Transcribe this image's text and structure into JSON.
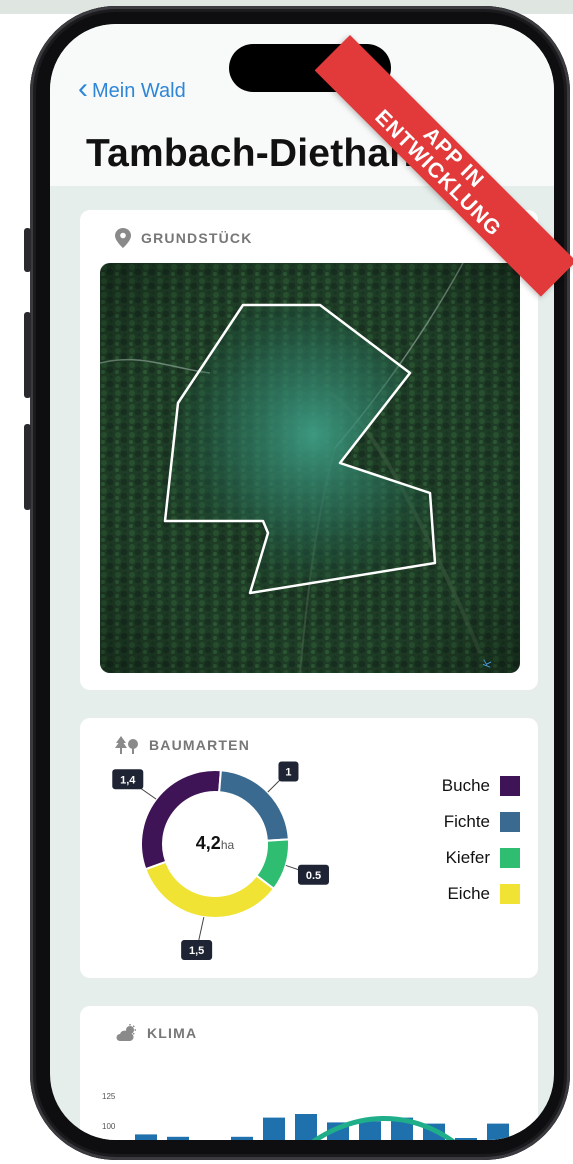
{
  "nav": {
    "back_label": "Mein Wald"
  },
  "header": {
    "title": "Tambach-Dietharz"
  },
  "banner": {
    "line1": "APP IN",
    "line2": "ENTWICKLUNG"
  },
  "cards": {
    "grundstueck": {
      "title": "GRUNDSTÜCK",
      "icon": "location-pin-icon"
    },
    "baumarten": {
      "title": "BAUMARTEN",
      "icon": "trees-icon"
    },
    "klima": {
      "title": "KLIMA",
      "icon": "cloud-sun-icon"
    }
  },
  "map": {
    "attribution_glyph": "K"
  },
  "chart_data": [
    {
      "type": "pie",
      "variant": "donut",
      "title": "BAUMARTEN",
      "center_value": "4,2",
      "center_unit": "ha",
      "categories": [
        "Buche",
        "Fichte",
        "Kiefer",
        "Eiche"
      ],
      "values": [
        1.4,
        1,
        0.5,
        1.5
      ],
      "value_labels": [
        "1,4",
        "1",
        "0.5",
        "1,5"
      ],
      "colors": [
        "#3f1456",
        "#3a6a8f",
        "#2fbd72",
        "#f0e334"
      ],
      "legend_position": "right"
    },
    {
      "type": "bar",
      "title": "KLIMA",
      "yticks": [
        "125",
        "100"
      ],
      "ylim": [
        75,
        125
      ],
      "values": [
        93,
        91,
        86,
        91,
        107,
        110,
        103,
        104,
        107,
        102,
        90,
        102
      ],
      "bar_color": "#1f71ad",
      "overlay_line_color": "#1fae8a"
    }
  ]
}
